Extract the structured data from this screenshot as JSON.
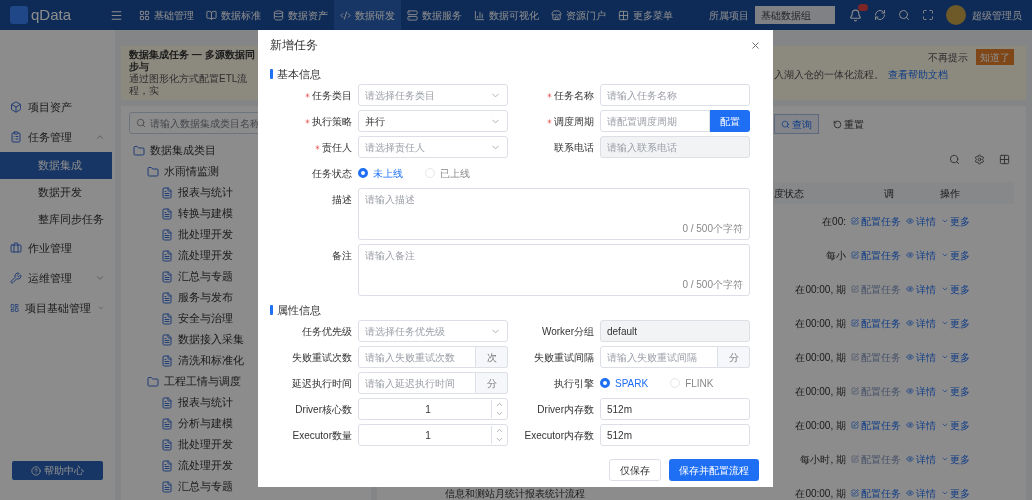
{
  "nav": {
    "logo": "qData",
    "items": [
      {
        "label": "基础管理",
        "selected": false
      },
      {
        "label": "数据标准",
        "selected": false
      },
      {
        "label": "数据资产",
        "selected": false
      },
      {
        "label": "数据研发",
        "selected": true
      },
      {
        "label": "数据服务",
        "selected": false
      },
      {
        "label": "数据可视化",
        "selected": false
      },
      {
        "label": "资源门户",
        "selected": false
      },
      {
        "label": "更多菜单",
        "selected": false
      }
    ],
    "project_label": "所属项目",
    "project_value": "基础数据组",
    "user": "超级管理员"
  },
  "sidebar": {
    "items": [
      {
        "label": "项目资产",
        "kind": "link"
      },
      {
        "label": "任务管理",
        "kind": "group",
        "expanded": true,
        "children": [
          {
            "label": "数据集成",
            "selected": true
          },
          {
            "label": "数据开发",
            "selected": false
          },
          {
            "label": "整库同步任务",
            "selected": false
          }
        ]
      },
      {
        "label": "作业管理",
        "kind": "link"
      },
      {
        "label": "运维管理",
        "kind": "group",
        "expanded": false
      },
      {
        "label": "项目基础管理",
        "kind": "group",
        "expanded": false
      }
    ],
    "help": "帮助中心"
  },
  "banner": {
    "title": "数据集成任务 — 多源数据同步与",
    "text": "通过图形化方式配置ETL流程，实",
    "text_end": "入湖入仓的一体化流程。",
    "link": "查看帮助文档",
    "dismiss": "不再提示",
    "button": "知道了"
  },
  "tree": {
    "placeholder": "请输入数据集成类目名称",
    "items": [
      {
        "label": "数据集成类目",
        "children": [
          {
            "label": "水雨情监测",
            "children": [
              {
                "label": "报表与统计"
              },
              {
                "label": "转换与建模"
              },
              {
                "label": "批处理开发"
              },
              {
                "label": "流处理开发"
              },
              {
                "label": "汇总与专题"
              },
              {
                "label": "服务与发布"
              },
              {
                "label": "安全与治理"
              },
              {
                "label": "数据接入采集"
              },
              {
                "label": "清洗和标准化"
              }
            ]
          },
          {
            "label": "工程工情与调度",
            "children": [
              {
                "label": "报表与统计"
              },
              {
                "label": "分析与建模"
              },
              {
                "label": "批处理开发"
              },
              {
                "label": "流处理开发"
              },
              {
                "label": "汇总与专题"
              }
            ]
          }
        ]
      }
    ]
  },
  "table": {
    "query": "查询",
    "reset": "重置",
    "columns": [
      "度状态",
      "调",
      "操作"
    ],
    "rows": [
      {
        "schedule": "在00:",
        "config": "配置任务",
        "config_disabled": false,
        "detail": "详情",
        "more": "更多"
      },
      {
        "schedule": "每小",
        "config": "配置任务",
        "config_disabled": false,
        "detail": "详情",
        "more": "更多"
      },
      {
        "schedule": "在00:00, 期",
        "config": "配置任务",
        "config_disabled": true,
        "detail": "详情",
        "more": "更多"
      },
      {
        "schedule": "在00:00, 期",
        "config": "配置任务",
        "config_disabled": false,
        "detail": "详情",
        "more": "更多"
      },
      {
        "schedule": "在00:00, 期",
        "config": "配置任务",
        "config_disabled": true,
        "detail": "详情",
        "more": "更多"
      },
      {
        "schedule": "在00:00, 期",
        "config": "配置任务",
        "config_disabled": true,
        "detail": "详情",
        "more": "更多"
      },
      {
        "schedule": "在00:00, 期",
        "config": "配置任务",
        "config_disabled": false,
        "detail": "详情",
        "more": "更多"
      },
      {
        "schedule": "每小时, 期",
        "config": "配置任务",
        "config_disabled": true,
        "detail": "详情",
        "more": "更多"
      },
      {
        "description": "信息和测站月统计报表统计流程",
        "schedule": "在00:00, 期",
        "config": "配置任务",
        "config_disabled": false,
        "detail": "详情",
        "more": "更多"
      }
    ]
  },
  "modal": {
    "title": "新增任务",
    "sections": [
      {
        "title": "基本信息",
        "fields": [
          {
            "kind": "select",
            "label": "任务类目",
            "required": true,
            "placeholder": "请选择任务类目"
          },
          {
            "kind": "input",
            "label": "任务名称",
            "required": true,
            "placeholder": "请输入任务名称"
          },
          {
            "kind": "select",
            "label": "执行策略",
            "required": true,
            "value": "并行"
          },
          {
            "kind": "input_button",
            "label": "调度周期",
            "required": true,
            "placeholder": "请配置调度周期",
            "button": "配置"
          },
          {
            "kind": "select",
            "label": "责任人",
            "required": true,
            "placeholder": "请选择责任人"
          },
          {
            "kind": "input",
            "label": "联系电话",
            "placeholder": "请输入联系电话",
            "disabled": true
          },
          {
            "kind": "radio",
            "label": "任务状态",
            "options": [
              {
                "label": "未上线",
                "selected": true
              },
              {
                "label": "已上线",
                "selected": false
              }
            ]
          },
          {
            "kind": "textarea",
            "label": "描述",
            "placeholder": "请输入描述",
            "counter": "0 / 500个字符"
          },
          {
            "kind": "textarea",
            "label": "备注",
            "placeholder": "请输入备注",
            "counter": "0 / 500个字符"
          }
        ]
      },
      {
        "title": "属性信息",
        "fields": [
          {
            "kind": "select",
            "label": "任务优先级",
            "placeholder": "请选择任务优先级"
          },
          {
            "kind": "input",
            "label": "Worker分组",
            "value": "default",
            "disabled": true
          },
          {
            "kind": "input_suffix",
            "label": "失败重试次数",
            "placeholder": "请输入失败重试次数",
            "suffix": "次"
          },
          {
            "kind": "input_suffix",
            "label": "失败重试间隔",
            "placeholder": "请输入失败重试间隔",
            "suffix": "分"
          },
          {
            "kind": "input_suffix",
            "label": "延迟执行时间",
            "placeholder": "请输入延迟执行时间",
            "suffix": "分"
          },
          {
            "kind": "radio",
            "label": "执行引擎",
            "options": [
              {
                "label": "SPARK",
                "selected": true
              },
              {
                "label": "FLINK",
                "selected": false
              }
            ]
          },
          {
            "kind": "number",
            "label": "Driver核心数",
            "value": "1"
          },
          {
            "kind": "input",
            "label": "Driver内存数",
            "value": "512m",
            "disabled": false
          },
          {
            "kind": "number",
            "label": "Executor数量",
            "value": "1"
          },
          {
            "kind": "input",
            "label": "Executor内存数",
            "value": "512m",
            "disabled": false
          }
        ]
      }
    ],
    "buttons": [
      {
        "label": "仅保存",
        "kind": "default"
      },
      {
        "label": "保存并配置流程",
        "kind": "primary"
      }
    ]
  }
}
